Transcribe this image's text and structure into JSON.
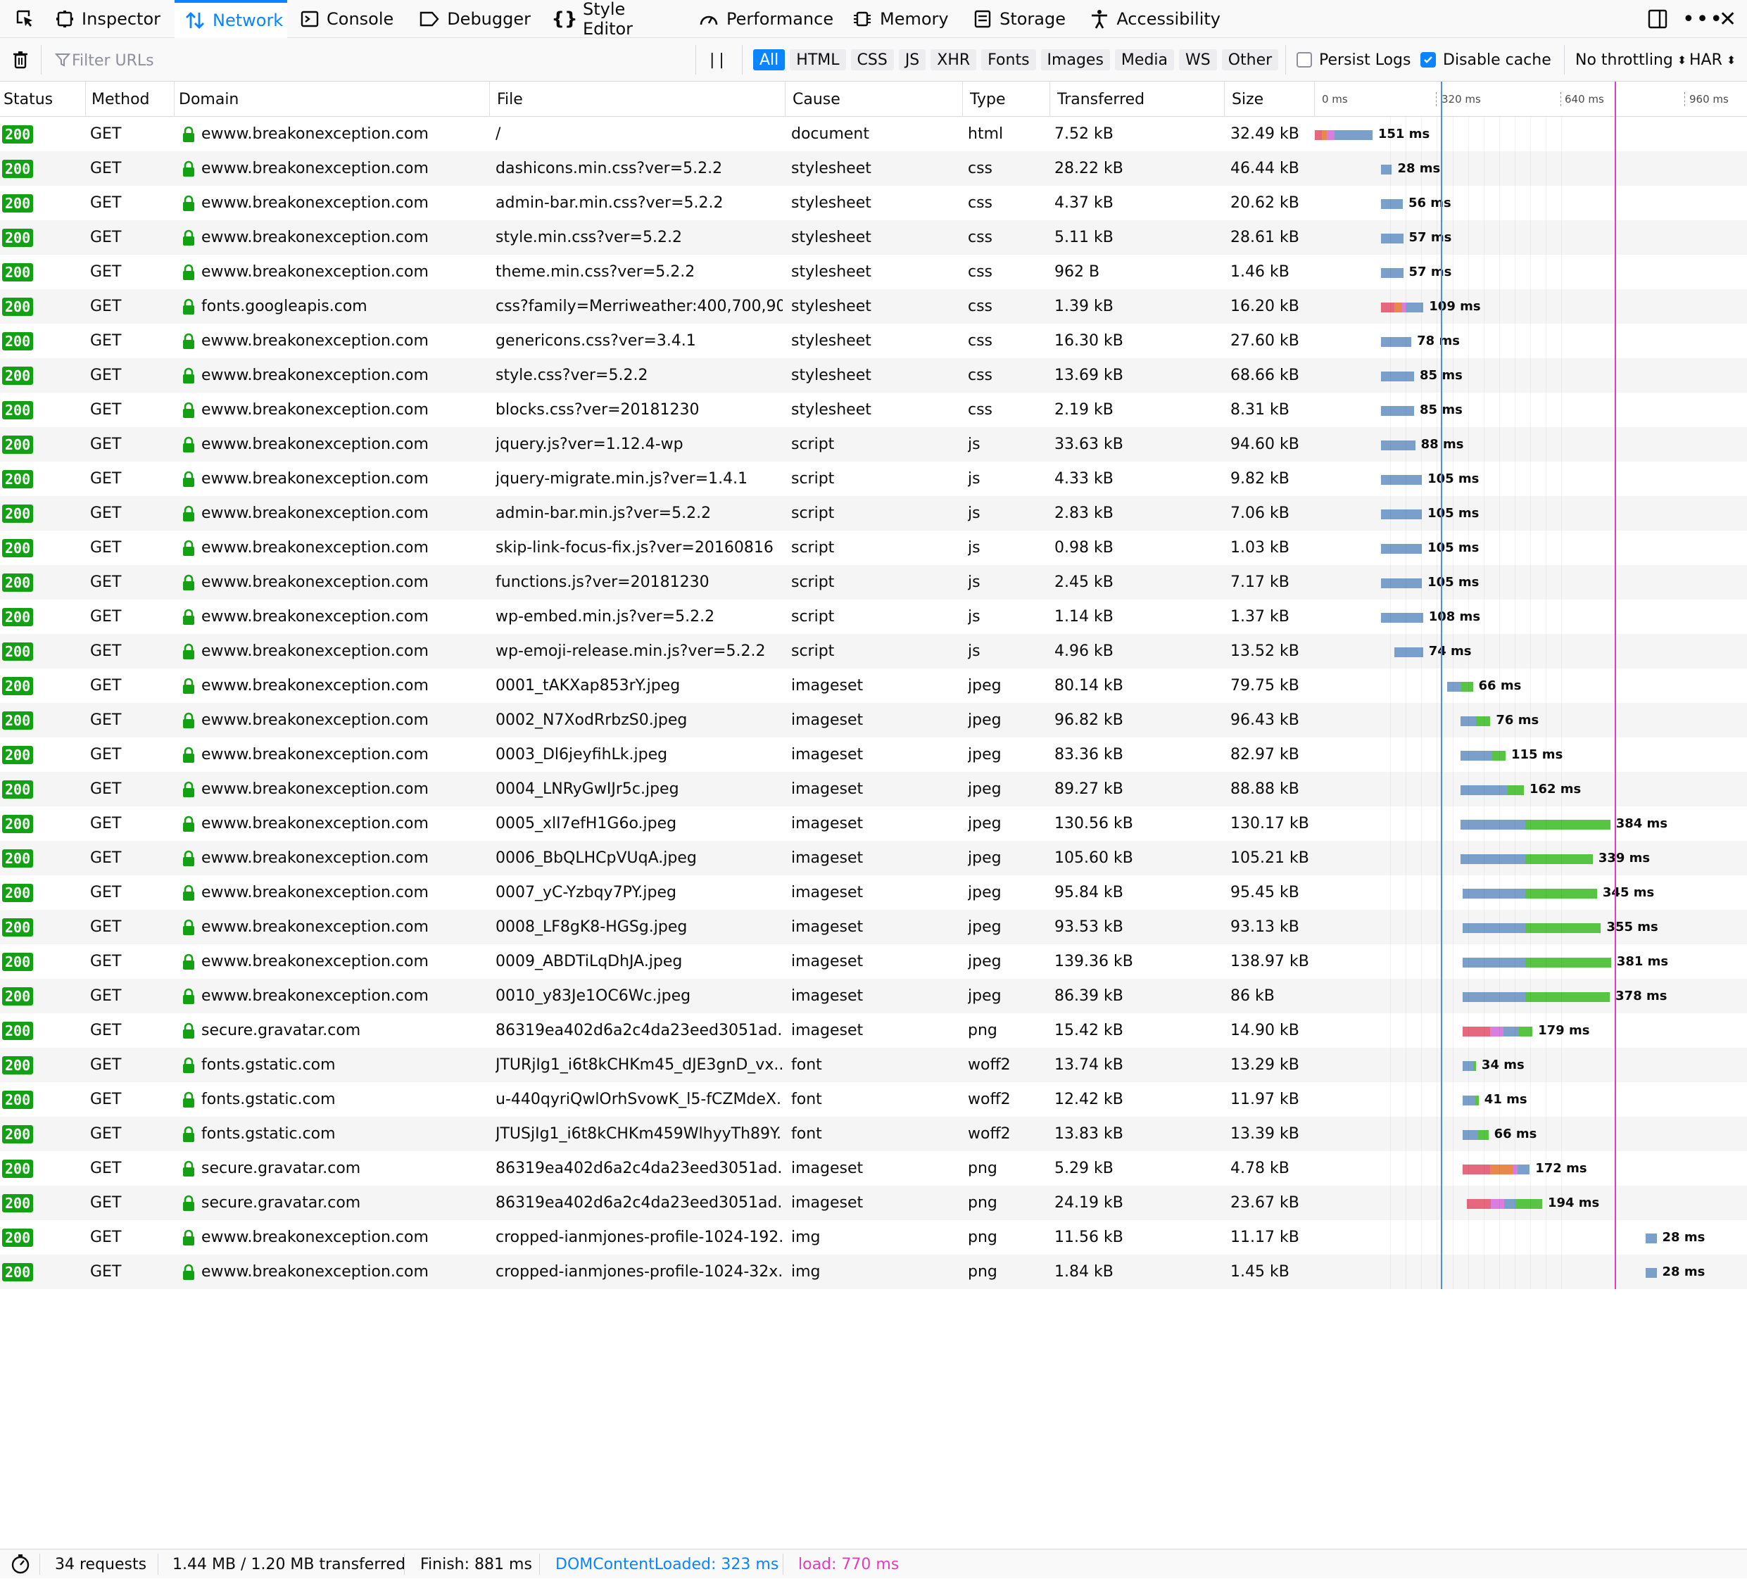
{
  "tabs": [
    {
      "label": "Inspector",
      "icon": "inspector-icon"
    },
    {
      "label": "Network",
      "icon": "network-icon"
    },
    {
      "label": "Console",
      "icon": "console-icon"
    },
    {
      "label": "Debugger",
      "icon": "debugger-icon"
    },
    {
      "label": "Style Editor",
      "icon": "style-editor-icon"
    },
    {
      "label": "Performance",
      "icon": "performance-icon"
    },
    {
      "label": "Memory",
      "icon": "memory-icon"
    },
    {
      "label": "Storage",
      "icon": "storage-icon"
    },
    {
      "label": "Accessibility",
      "icon": "accessibility-icon"
    }
  ],
  "active_tab": "Network",
  "filter": {
    "placeholder": "Filter URLs",
    "types": [
      "All",
      "HTML",
      "CSS",
      "JS",
      "XHR",
      "Fonts",
      "Images",
      "Media",
      "WS",
      "Other"
    ],
    "active_type": "All",
    "persist_logs": "Persist Logs",
    "persist_checked": false,
    "disable_cache": "Disable cache",
    "disable_checked": true,
    "throttling": "No throttling",
    "har": "HAR"
  },
  "columns": {
    "status": "Status",
    "method": "Method",
    "domain": "Domain",
    "file": "File",
    "cause": "Cause",
    "type": "Type",
    "transferred": "Transferred",
    "size": "Size"
  },
  "timeline_ticks": [
    "0 ms",
    "320 ms",
    "640 ms",
    "960 ms"
  ],
  "requests": [
    {
      "status": "200",
      "method": "GET",
      "domain": "ewww.breakonexception.com",
      "file": "/",
      "cause": "document",
      "type": "html",
      "transferred": "7.52 kB",
      "size": "32.49 kB",
      "duration": "151 ms",
      "start": 0,
      "phases": [
        [
          "b",
          18
        ],
        [
          "o",
          12
        ],
        [
          "p",
          20
        ],
        [
          "g",
          98
        ]
      ]
    },
    {
      "status": "200",
      "method": "GET",
      "domain": "ewww.breakonexception.com",
      "file": "dashicons.min.css?ver=5.2.2",
      "cause": "stylesheet",
      "type": "css",
      "transferred": "28.22 kB",
      "size": "46.44 kB",
      "duration": "28 ms",
      "start": 170,
      "phases": [
        [
          "g",
          28
        ]
      ]
    },
    {
      "status": "200",
      "method": "GET",
      "domain": "ewww.breakonexception.com",
      "file": "admin-bar.min.css?ver=5.2.2",
      "cause": "stylesheet",
      "type": "css",
      "transferred": "4.37 kB",
      "size": "20.62 kB",
      "duration": "56 ms",
      "start": 170,
      "phases": [
        [
          "g",
          56
        ]
      ]
    },
    {
      "status": "200",
      "method": "GET",
      "domain": "ewww.breakonexception.com",
      "file": "style.min.css?ver=5.2.2",
      "cause": "stylesheet",
      "type": "css",
      "transferred": "5.11 kB",
      "size": "28.61 kB",
      "duration": "57 ms",
      "start": 170,
      "phases": [
        [
          "g",
          57
        ]
      ]
    },
    {
      "status": "200",
      "method": "GET",
      "domain": "ewww.breakonexception.com",
      "file": "theme.min.css?ver=5.2.2",
      "cause": "stylesheet",
      "type": "css",
      "transferred": "962 B",
      "size": "1.46 kB",
      "duration": "57 ms",
      "start": 170,
      "phases": [
        [
          "g",
          57
        ]
      ]
    },
    {
      "status": "200",
      "method": "GET",
      "domain": "fonts.googleapis.com",
      "file": "css?family=Merriweather:400,700,90...",
      "cause": "stylesheet",
      "type": "css",
      "transferred": "1.39 kB",
      "size": "16.20 kB",
      "duration": "109 ms",
      "start": 170,
      "phases": [
        [
          "b",
          35
        ],
        [
          "o",
          20
        ],
        [
          "p",
          10
        ],
        [
          "g",
          44
        ]
      ]
    },
    {
      "status": "200",
      "method": "GET",
      "domain": "ewww.breakonexception.com",
      "file": "genericons.css?ver=3.4.1",
      "cause": "stylesheet",
      "type": "css",
      "transferred": "16.30 kB",
      "size": "27.60 kB",
      "duration": "78 ms",
      "start": 170,
      "phases": [
        [
          "g",
          78
        ]
      ]
    },
    {
      "status": "200",
      "method": "GET",
      "domain": "ewww.breakonexception.com",
      "file": "style.css?ver=5.2.2",
      "cause": "stylesheet",
      "type": "css",
      "transferred": "13.69 kB",
      "size": "68.66 kB",
      "duration": "85 ms",
      "start": 170,
      "phases": [
        [
          "g",
          85
        ]
      ]
    },
    {
      "status": "200",
      "method": "GET",
      "domain": "ewww.breakonexception.com",
      "file": "blocks.css?ver=20181230",
      "cause": "stylesheet",
      "type": "css",
      "transferred": "2.19 kB",
      "size": "8.31 kB",
      "duration": "85 ms",
      "start": 170,
      "phases": [
        [
          "g",
          85
        ]
      ]
    },
    {
      "status": "200",
      "method": "GET",
      "domain": "ewww.breakonexception.com",
      "file": "jquery.js?ver=1.12.4-wp",
      "cause": "script",
      "type": "js",
      "transferred": "33.63 kB",
      "size": "94.60 kB",
      "duration": "88 ms",
      "start": 170,
      "phases": [
        [
          "g",
          88
        ]
      ]
    },
    {
      "status": "200",
      "method": "GET",
      "domain": "ewww.breakonexception.com",
      "file": "jquery-migrate.min.js?ver=1.4.1",
      "cause": "script",
      "type": "js",
      "transferred": "4.33 kB",
      "size": "9.82 kB",
      "duration": "105 ms",
      "start": 170,
      "phases": [
        [
          "g",
          105
        ]
      ]
    },
    {
      "status": "200",
      "method": "GET",
      "domain": "ewww.breakonexception.com",
      "file": "admin-bar.min.js?ver=5.2.2",
      "cause": "script",
      "type": "js",
      "transferred": "2.83 kB",
      "size": "7.06 kB",
      "duration": "105 ms",
      "start": 170,
      "phases": [
        [
          "g",
          105
        ]
      ]
    },
    {
      "status": "200",
      "method": "GET",
      "domain": "ewww.breakonexception.com",
      "file": "skip-link-focus-fix.js?ver=20160816",
      "cause": "script",
      "type": "js",
      "transferred": "0.98 kB",
      "size": "1.03 kB",
      "duration": "105 ms",
      "start": 170,
      "phases": [
        [
          "g",
          105
        ]
      ]
    },
    {
      "status": "200",
      "method": "GET",
      "domain": "ewww.breakonexception.com",
      "file": "functions.js?ver=20181230",
      "cause": "script",
      "type": "js",
      "transferred": "2.45 kB",
      "size": "7.17 kB",
      "duration": "105 ms",
      "start": 170,
      "phases": [
        [
          "g",
          105
        ]
      ]
    },
    {
      "status": "200",
      "method": "GET",
      "domain": "ewww.breakonexception.com",
      "file": "wp-embed.min.js?ver=5.2.2",
      "cause": "script",
      "type": "js",
      "transferred": "1.14 kB",
      "size": "1.37 kB",
      "duration": "108 ms",
      "start": 170,
      "phases": [
        [
          "g",
          108
        ]
      ]
    },
    {
      "status": "200",
      "method": "GET",
      "domain": "ewww.breakonexception.com",
      "file": "wp-emoji-release.min.js?ver=5.2.2",
      "cause": "script",
      "type": "js",
      "transferred": "4.96 kB",
      "size": "13.52 kB",
      "duration": "74 ms",
      "start": 204,
      "phases": [
        [
          "g",
          74
        ]
      ]
    },
    {
      "status": "200",
      "method": "GET",
      "domain": "ewww.breakonexception.com",
      "file": "0001_tAKXap853rY.jpeg",
      "cause": "imageset",
      "type": "jpeg",
      "transferred": "80.14 kB",
      "size": "79.75 kB",
      "duration": "66 ms",
      "start": 340,
      "phases": [
        [
          "g",
          36
        ],
        [
          "r",
          30
        ]
      ]
    },
    {
      "status": "200",
      "method": "GET",
      "domain": "ewww.breakonexception.com",
      "file": "0002_N7XodRrbzS0.jpeg",
      "cause": "imageset",
      "type": "jpeg",
      "transferred": "96.82 kB",
      "size": "96.43 kB",
      "duration": "76 ms",
      "start": 375,
      "phases": [
        [
          "g",
          40
        ],
        [
          "r",
          36
        ]
      ]
    },
    {
      "status": "200",
      "method": "GET",
      "domain": "ewww.breakonexception.com",
      "file": "0003_Dl6jeyfihLk.jpeg",
      "cause": "imageset",
      "type": "jpeg",
      "transferred": "83.36 kB",
      "size": "82.97 kB",
      "duration": "115 ms",
      "start": 375,
      "phases": [
        [
          "g",
          80
        ],
        [
          "r",
          35
        ]
      ]
    },
    {
      "status": "200",
      "method": "GET",
      "domain": "ewww.breakonexception.com",
      "file": "0004_LNRyGwIJr5c.jpeg",
      "cause": "imageset",
      "type": "jpeg",
      "transferred": "89.27 kB",
      "size": "88.88 kB",
      "duration": "162 ms",
      "start": 375,
      "phases": [
        [
          "g",
          120
        ],
        [
          "r",
          42
        ]
      ]
    },
    {
      "status": "200",
      "method": "GET",
      "domain": "ewww.breakonexception.com",
      "file": "0005_xlI7efH1G6o.jpeg",
      "cause": "imageset",
      "type": "jpeg",
      "transferred": "130.56 kB",
      "size": "130.17 kB",
      "duration": "384 ms",
      "start": 375,
      "phases": [
        [
          "g",
          165
        ],
        [
          "r",
          219
        ]
      ]
    },
    {
      "status": "200",
      "method": "GET",
      "domain": "ewww.breakonexception.com",
      "file": "0006_BbQLHCpVUqA.jpeg",
      "cause": "imageset",
      "type": "jpeg",
      "transferred": "105.60 kB",
      "size": "105.21 kB",
      "duration": "339 ms",
      "start": 375,
      "phases": [
        [
          "g",
          165
        ],
        [
          "r",
          174
        ]
      ]
    },
    {
      "status": "200",
      "method": "GET",
      "domain": "ewww.breakonexception.com",
      "file": "0007_yC-Yzbqy7PY.jpeg",
      "cause": "imageset",
      "type": "jpeg",
      "transferred": "95.84 kB",
      "size": "95.45 kB",
      "duration": "345 ms",
      "start": 380,
      "phases": [
        [
          "g",
          160
        ],
        [
          "r",
          185
        ]
      ]
    },
    {
      "status": "200",
      "method": "GET",
      "domain": "ewww.breakonexception.com",
      "file": "0008_LF8gK8-HGSg.jpeg",
      "cause": "imageset",
      "type": "jpeg",
      "transferred": "93.53 kB",
      "size": "93.13 kB",
      "duration": "355 ms",
      "start": 380,
      "phases": [
        [
          "g",
          160
        ],
        [
          "r",
          195
        ]
      ]
    },
    {
      "status": "200",
      "method": "GET",
      "domain": "ewww.breakonexception.com",
      "file": "0009_ABDTiLqDhJA.jpeg",
      "cause": "imageset",
      "type": "jpeg",
      "transferred": "139.36 kB",
      "size": "138.97 kB",
      "duration": "381 ms",
      "start": 380,
      "phases": [
        [
          "g",
          160
        ],
        [
          "r",
          221
        ]
      ]
    },
    {
      "status": "200",
      "method": "GET",
      "domain": "ewww.breakonexception.com",
      "file": "0010_y83Je1OC6Wc.jpeg",
      "cause": "imageset",
      "type": "jpeg",
      "transferred": "86.39 kB",
      "size": "86 kB",
      "duration": "378 ms",
      "start": 380,
      "phases": [
        [
          "g",
          160
        ],
        [
          "r",
          218
        ]
      ]
    },
    {
      "status": "200",
      "method": "GET",
      "domain": "secure.gravatar.com",
      "file": "86319ea402d6a2c4da23eed3051ad...",
      "cause": "imageset",
      "type": "png",
      "transferred": "15.42 kB",
      "size": "14.90 kB",
      "duration": "179 ms",
      "start": 380,
      "phases": [
        [
          "b",
          70
        ],
        [
          "m",
          35
        ],
        [
          "g",
          40
        ],
        [
          "r",
          34
        ]
      ]
    },
    {
      "status": "200",
      "method": "GET",
      "domain": "fonts.gstatic.com",
      "file": "JTURjIg1_i6t8kCHKm45_dJE3gnD_vx...",
      "cause": "font",
      "type": "woff2",
      "transferred": "13.74 kB",
      "size": "13.29 kB",
      "duration": "34 ms",
      "start": 380,
      "phases": [
        [
          "g",
          26
        ],
        [
          "r",
          8
        ]
      ]
    },
    {
      "status": "200",
      "method": "GET",
      "domain": "fonts.gstatic.com",
      "file": "u-440qyriQwlOrhSvowK_l5-fCZMdeX...",
      "cause": "font",
      "type": "woff2",
      "transferred": "12.42 kB",
      "size": "11.97 kB",
      "duration": "41 ms",
      "start": 380,
      "phases": [
        [
          "g",
          32
        ],
        [
          "r",
          9
        ]
      ]
    },
    {
      "status": "200",
      "method": "GET",
      "domain": "fonts.gstatic.com",
      "file": "JTUSjIg1_i6t8kCHKm459WlhyyTh89Y...",
      "cause": "font",
      "type": "woff2",
      "transferred": "13.83 kB",
      "size": "13.39 kB",
      "duration": "66 ms",
      "start": 380,
      "phases": [
        [
          "g",
          40
        ],
        [
          "r",
          26
        ]
      ]
    },
    {
      "status": "200",
      "method": "GET",
      "domain": "secure.gravatar.com",
      "file": "86319ea402d6a2c4da23eed3051ad...",
      "cause": "imageset",
      "type": "png",
      "transferred": "5.29 kB",
      "size": "4.78 kB",
      "duration": "172 ms",
      "start": 380,
      "phases": [
        [
          "b",
          70
        ],
        [
          "o",
          60
        ],
        [
          "p",
          10
        ],
        [
          "g",
          32
        ]
      ]
    },
    {
      "status": "200",
      "method": "GET",
      "domain": "secure.gravatar.com",
      "file": "86319ea402d6a2c4da23eed3051ad...",
      "cause": "imageset",
      "type": "png",
      "transferred": "24.19 kB",
      "size": "23.67 kB",
      "duration": "194 ms",
      "start": 390,
      "phases": [
        [
          "b",
          62
        ],
        [
          "m",
          35
        ],
        [
          "g",
          30
        ],
        [
          "r",
          67
        ]
      ]
    },
    {
      "status": "200",
      "method": "GET",
      "domain": "ewww.breakonexception.com",
      "file": "cropped-ianmjones-profile-1024-192...",
      "cause": "img",
      "type": "png",
      "transferred": "11.56 kB",
      "size": "11.17 kB",
      "duration": "28 ms",
      "start": 850,
      "phases": [
        [
          "g",
          28
        ]
      ]
    },
    {
      "status": "200",
      "method": "GET",
      "domain": "ewww.breakonexception.com",
      "file": "cropped-ianmjones-profile-1024-32x...",
      "cause": "img",
      "type": "png",
      "transferred": "1.84 kB",
      "size": "1.45 kB",
      "duration": "28 ms",
      "start": 850,
      "phases": [
        [
          "g",
          28
        ]
      ]
    }
  ],
  "markers": {
    "dom_content_loaded_ms": 323,
    "load_ms": 770
  },
  "colors": {
    "accent": "#0a84ff",
    "status_ok": "#12a112",
    "blocked": "#e5687f",
    "dns": "#e8884a",
    "connect": "#e8884a",
    "ssl": "#d97ee0",
    "waiting": "#7b9fcb",
    "receiving": "#57c444",
    "dcl": "#4a90e2",
    "load": "#e03ebf"
  },
  "statusbar": {
    "requests": "34 requests",
    "size": "1.44 MB / 1.20 MB transferred",
    "finish": "Finish: 881 ms",
    "dcl": "DOMContentLoaded: 323 ms",
    "load": "load: 770 ms"
  }
}
